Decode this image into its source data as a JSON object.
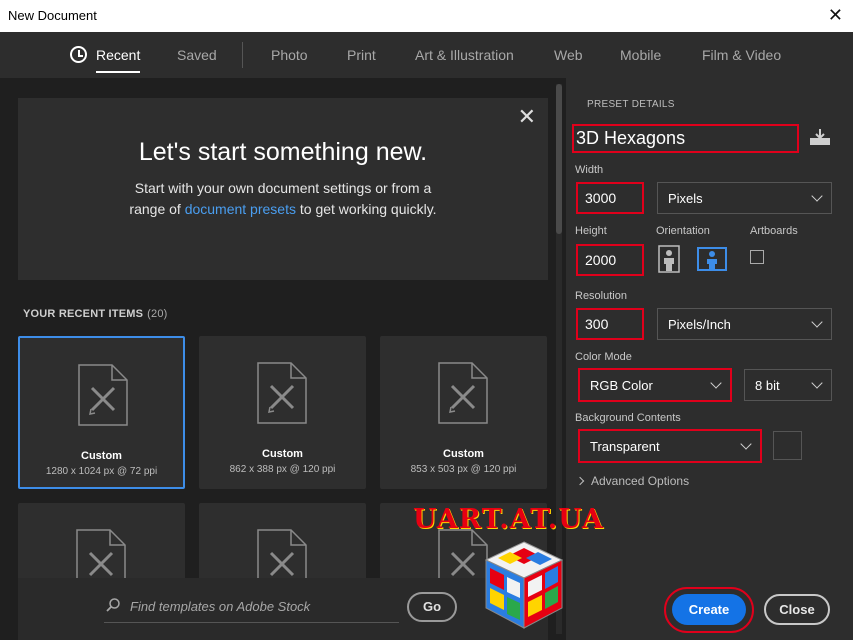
{
  "window": {
    "title": "New Document",
    "close": "✕"
  },
  "tabs": [
    {
      "label": "Recent",
      "active": true
    },
    {
      "label": "Saved"
    },
    {
      "label": "Photo"
    },
    {
      "label": "Print"
    },
    {
      "label": "Art & Illustration"
    },
    {
      "label": "Web"
    },
    {
      "label": "Mobile"
    },
    {
      "label": "Film & Video"
    }
  ],
  "hero": {
    "title": "Let's start something new.",
    "text_before": "Start with your own document settings or from a range of ",
    "link": "document presets",
    "text_after": " to get working quickly.",
    "close": "✕"
  },
  "recent": {
    "heading": "YOUR RECENT ITEMS",
    "count": "(20)",
    "items": [
      {
        "name": "Custom",
        "size": "1280 x 1024 px @ 72 ppi",
        "selected": true
      },
      {
        "name": "Custom",
        "size": "862 x 388 px @ 120 ppi"
      },
      {
        "name": "Custom",
        "size": "853 x 503 px @ 120 ppi"
      }
    ]
  },
  "search": {
    "placeholder": "Find templates on Adobe Stock",
    "go": "Go"
  },
  "preset": {
    "heading": "PRESET DETAILS",
    "name": "3D Hexagons",
    "width_label": "Width",
    "width": "3000",
    "width_unit": "Pixels",
    "height_label": "Height",
    "height": "2000",
    "orientation_label": "Orientation",
    "artboards_label": "Artboards",
    "resolution_label": "Resolution",
    "resolution": "300",
    "resolution_unit": "Pixels/Inch",
    "color_mode_label": "Color Mode",
    "color_mode": "RGB Color",
    "bit_depth": "8 bit",
    "background_label": "Background Contents",
    "background": "Transparent",
    "advanced": "Advanced Options"
  },
  "buttons": {
    "create": "Create",
    "close": "Close"
  },
  "watermark": "UART.AT.UA",
  "colors": {
    "accent": "#1473e6",
    "highlight": "#e0001b",
    "link": "#4a9ef0"
  }
}
